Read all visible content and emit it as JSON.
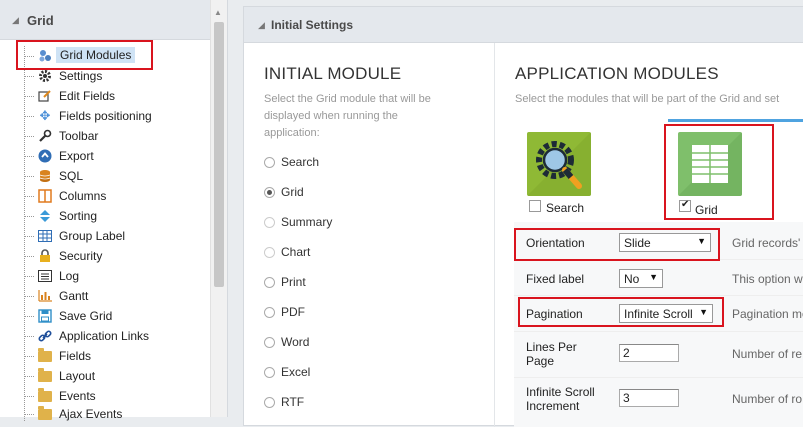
{
  "sidebar": {
    "title": "Grid",
    "items": [
      {
        "label": "Grid Modules",
        "icon": "grid-modules-icon"
      },
      {
        "label": "Settings",
        "icon": "gear-icon"
      },
      {
        "label": "Edit Fields",
        "icon": "edit-icon"
      },
      {
        "label": "Fields positioning",
        "icon": "move-icon"
      },
      {
        "label": "Toolbar",
        "icon": "wrench-icon"
      },
      {
        "label": "Export",
        "icon": "export-icon"
      },
      {
        "label": "SQL",
        "icon": "database-icon"
      },
      {
        "label": "Columns",
        "icon": "columns-icon"
      },
      {
        "label": "Sorting",
        "icon": "sort-icon"
      },
      {
        "label": "Group Label",
        "icon": "table-icon"
      },
      {
        "label": "Security",
        "icon": "lock-icon"
      },
      {
        "label": "Log",
        "icon": "log-icon"
      },
      {
        "label": "Gantt",
        "icon": "gantt-icon"
      },
      {
        "label": "Save Grid",
        "icon": "save-icon"
      },
      {
        "label": "Application Links",
        "icon": "link-icon"
      },
      {
        "label": "Fields",
        "icon": "folder-icon"
      },
      {
        "label": "Layout",
        "icon": "folder-icon"
      },
      {
        "label": "Events",
        "icon": "folder-icon"
      },
      {
        "label": "Ajax Events",
        "icon": "folder-icon"
      }
    ]
  },
  "panel": {
    "title": "Initial Settings"
  },
  "initial_module": {
    "title": "INITIAL MODULE",
    "description": "Select the Grid module that will be displayed when running the application:",
    "desc_lines": [
      "Select the Grid module that will be",
      "displayed when running the",
      "application:"
    ],
    "options": [
      {
        "label": "Search",
        "checked": false,
        "disabled": false
      },
      {
        "label": "Grid",
        "checked": true,
        "disabled": false
      },
      {
        "label": "Summary",
        "checked": false,
        "disabled": true
      },
      {
        "label": "Chart",
        "checked": false,
        "disabled": true
      },
      {
        "label": "Print",
        "checked": false,
        "disabled": false
      },
      {
        "label": "PDF",
        "checked": false,
        "disabled": false
      },
      {
        "label": "Word",
        "checked": false,
        "disabled": false
      },
      {
        "label": "Excel",
        "checked": false,
        "disabled": false
      },
      {
        "label": "RTF",
        "checked": false,
        "disabled": false
      }
    ]
  },
  "app_modules": {
    "title": "APPLICATION MODULES",
    "description": "Select the modules that will be part of the Grid and set",
    "modules": [
      {
        "label": "Search",
        "checked": false,
        "icon": "magnifier-gear-icon"
      },
      {
        "label": "Grid",
        "checked": true,
        "icon": "grid-table-icon"
      }
    ],
    "settings": {
      "orientation": {
        "label": "Orientation",
        "value": "Slide",
        "desc": "Grid records'"
      },
      "fixed_label": {
        "label": "Fixed label",
        "value": "No",
        "desc": "This option w"
      },
      "pagination": {
        "label": "Pagination",
        "value": "Infinite Scroll",
        "desc": "Pagination mo"
      },
      "lines_per_page": {
        "label_l1": "Lines Per",
        "label_l2": "Page",
        "value": "2",
        "desc": "Number of re"
      },
      "infinite_scroll": {
        "label_l1": "Infinite Scroll",
        "label_l2": "Increment",
        "value": "3",
        "desc": "Number of ro"
      }
    }
  },
  "colors": {
    "highlight_box": "#d9141e",
    "selected_item_bg": "#cfe3f5",
    "tab_accent": "#4fa3e0",
    "search_module_bg": "#8fb935",
    "grid_module_bg": "#7fbf6b"
  }
}
